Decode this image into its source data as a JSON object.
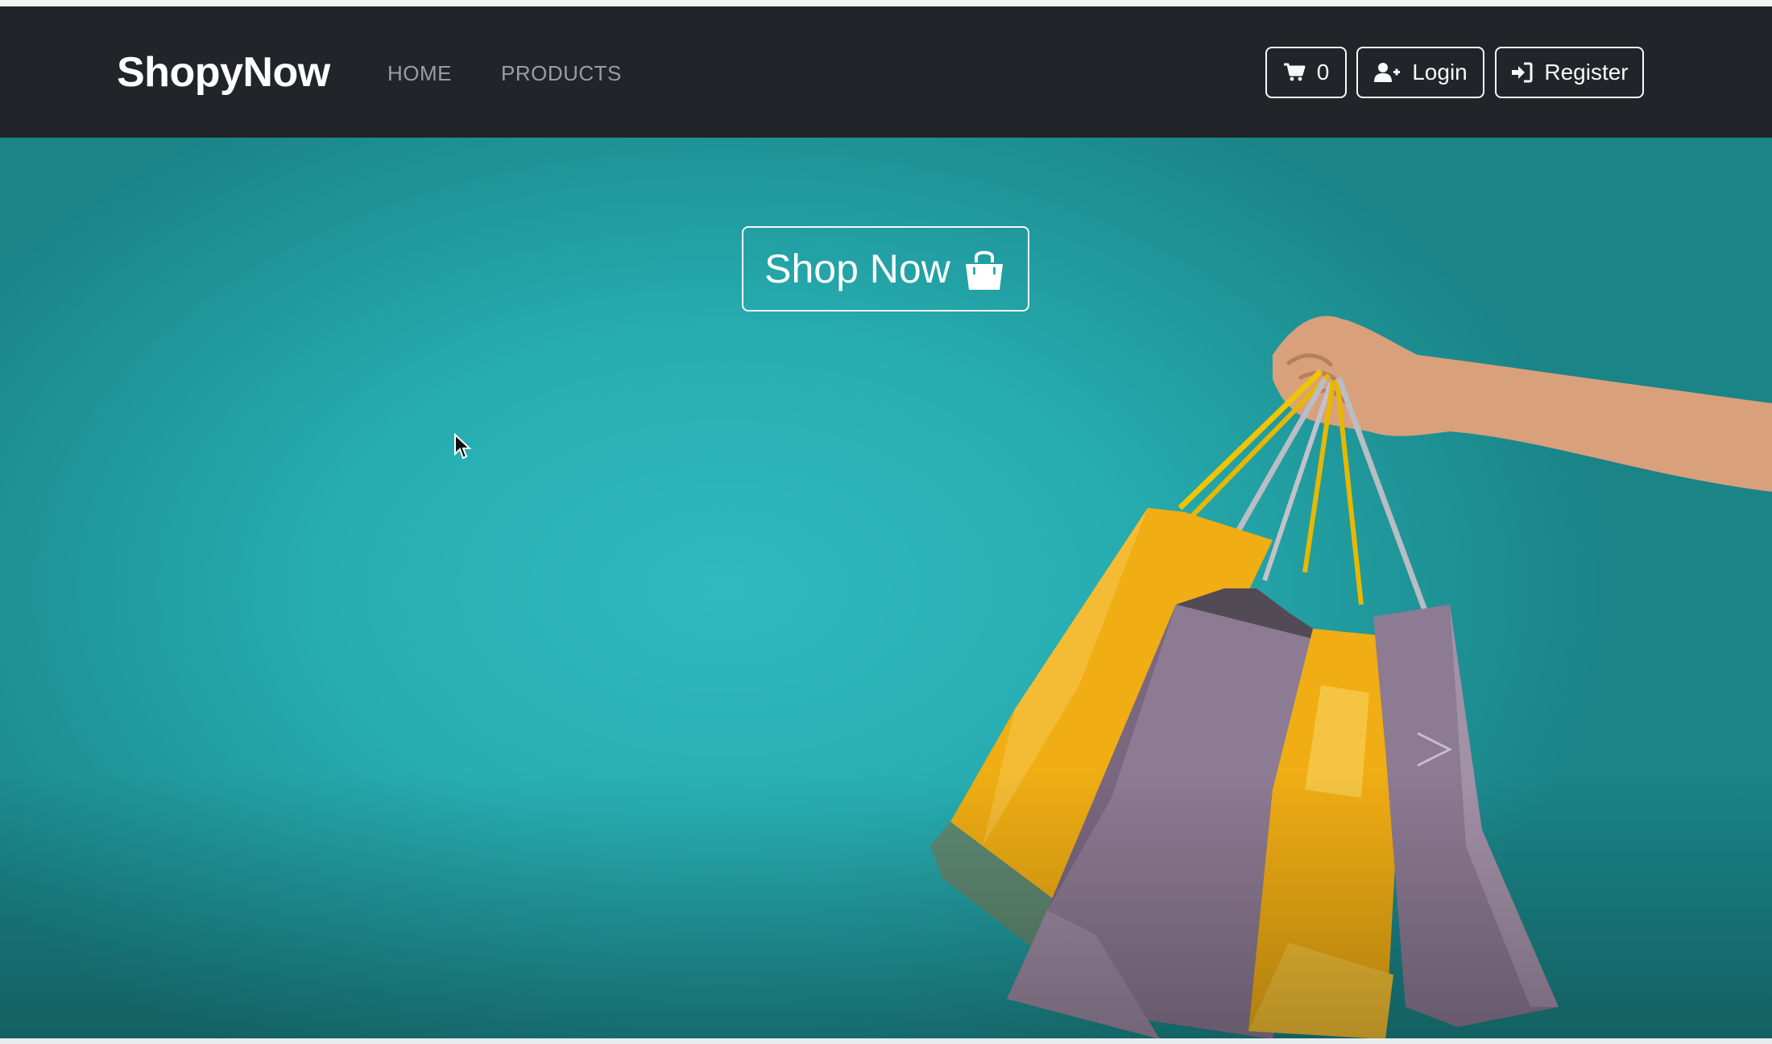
{
  "navbar": {
    "brand": "ShopyNow",
    "links": [
      {
        "label": "HOME"
      },
      {
        "label": "PRODUCTS"
      }
    ],
    "cart": {
      "icon": "cart-icon",
      "count": "0"
    },
    "login": {
      "icon": "user-plus-icon",
      "label": "Login"
    },
    "register": {
      "icon": "sign-in-icon",
      "label": "Register"
    }
  },
  "hero": {
    "cta_label": "Shop Now",
    "cta_icon": "shopping-bag-icon",
    "background_color": "#2ab3b8",
    "image": "hand holding yellow and purple shopping bags"
  },
  "colors": {
    "navbar": "#212529",
    "nav_link": "#9a9da1",
    "outline_button": "#f8f9fa"
  }
}
